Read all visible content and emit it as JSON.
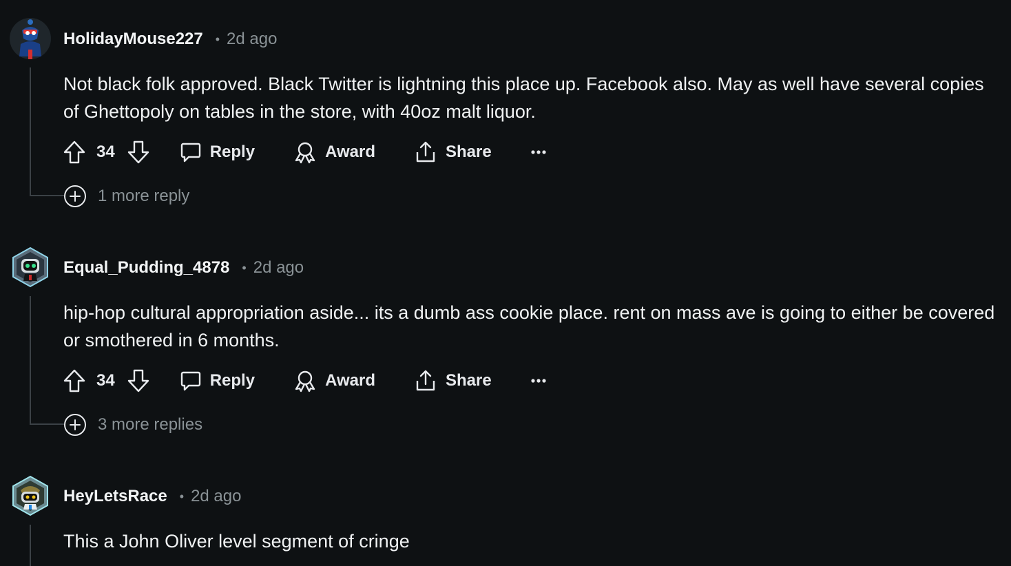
{
  "comments": [
    {
      "username": "HolidayMouse227",
      "separator": "•",
      "time": "2d ago",
      "text": "Not black folk approved.  Black Twitter is lightning this place up. Facebook also. May as well have several copies of Ghettopoly on tables in the store, with 40oz malt liquor.",
      "votes": "34",
      "reply_label": "Reply",
      "award_label": "Award",
      "share_label": "Share",
      "more_replies": "1 more reply"
    },
    {
      "username": "Equal_Pudding_4878",
      "separator": "•",
      "time": "2d ago",
      "text": "hip-hop cultural appropriation aside... its a dumb ass cookie place. rent on mass ave is going to either be covered or smothered in 6 months.",
      "votes": "34",
      "reply_label": "Reply",
      "award_label": "Award",
      "share_label": "Share",
      "more_replies": "3 more replies"
    },
    {
      "username": "HeyLetsRace",
      "separator": "•",
      "time": "2d ago",
      "text": "This a John Oliver level segment of cringe"
    }
  ],
  "colors": {
    "background": "#0e1113",
    "text": "#f0f2f3",
    "muted": "#8a9296",
    "thread_line": "#3b4146"
  },
  "icons": [
    "upvote-icon",
    "downvote-icon",
    "comment-icon",
    "award-icon",
    "share-icon",
    "more-options-icon",
    "expand-plus-icon"
  ]
}
